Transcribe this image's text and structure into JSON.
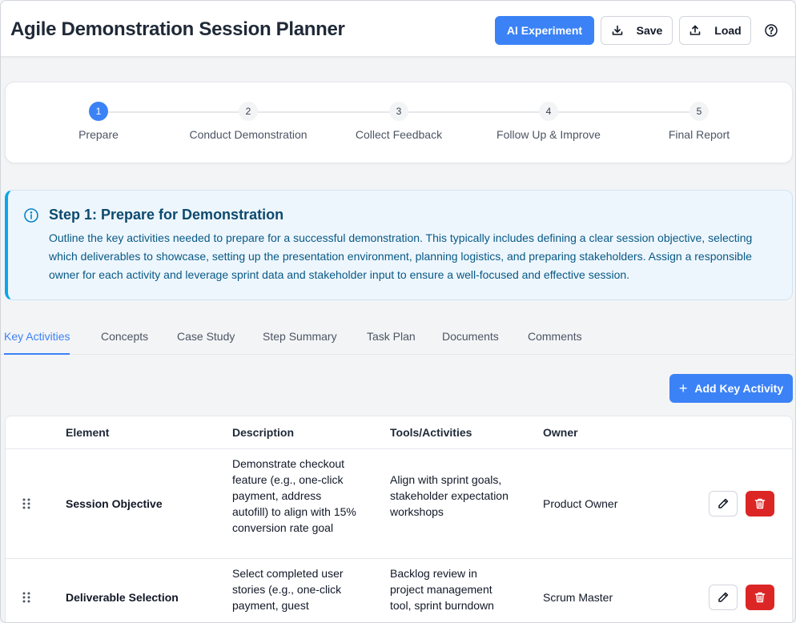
{
  "header": {
    "title": "Agile Demonstration Session Planner",
    "ai_label": "AI Experiment",
    "save_label": "Save",
    "load_label": "Load"
  },
  "stepper": {
    "steps": [
      {
        "num": "1",
        "label": "Prepare"
      },
      {
        "num": "2",
        "label": "Conduct Demonstration"
      },
      {
        "num": "3",
        "label": "Collect Feedback"
      },
      {
        "num": "4",
        "label": "Follow Up & Improve"
      },
      {
        "num": "5",
        "label": "Final Report"
      }
    ],
    "active_index": 0
  },
  "callout": {
    "title": "Step 1: Prepare for Demonstration",
    "body": "Outline the key activities needed to prepare for a successful demonstration. This typically includes defining a clear session objective, selecting which deliverables to showcase, setting up the presentation environment, planning logistics, and preparing stakeholders. Assign a responsible owner for each activity and leverage sprint data and stakeholder input to ensure a well-focused and effective session."
  },
  "tabs": [
    {
      "label": "Key Activities",
      "active": true
    },
    {
      "label": "Concepts"
    },
    {
      "label": "Case Study"
    },
    {
      "label": "Step Summary"
    },
    {
      "label": "Task Plan"
    },
    {
      "label": "Documents"
    },
    {
      "label": "Comments"
    }
  ],
  "add_button_label": "Add Key Activity",
  "table": {
    "columns": [
      "Element",
      "Description",
      "Tools/Activities",
      "Owner"
    ],
    "rows": [
      {
        "element": "Session Objective",
        "description": "Demonstrate checkout feature (e.g., one-click payment, address autofill) to align with 15% conversion rate goal",
        "tools": "Align with sprint goals, stakeholder expectation workshops",
        "owner": "Product Owner"
      },
      {
        "element": "Deliverable Selection",
        "description": "Select completed user stories (e.g., one-click payment, guest",
        "tools": "Backlog review in project management tool, sprint burndown",
        "owner": "Scrum Master"
      }
    ]
  },
  "colors": {
    "primary": "#3b82f6",
    "danger": "#dc2626",
    "callout_bg": "#eef6fd",
    "callout_accent": "#0ea5e9"
  }
}
